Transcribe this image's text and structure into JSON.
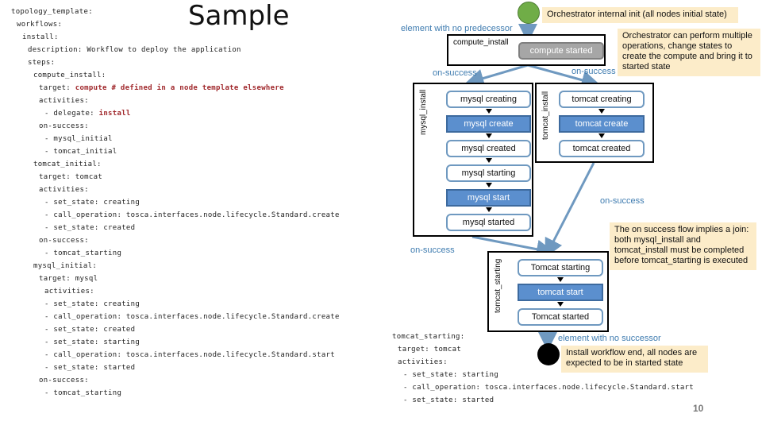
{
  "slide": {
    "title": "Sample",
    "page_number": "10"
  },
  "code": {
    "lines": [
      {
        "indent": 0,
        "text": "topology_template:"
      },
      {
        "indent": 1,
        "text": "workflows:"
      },
      {
        "indent": 2,
        "text": "install:"
      },
      {
        "indent": 3,
        "text": "description: Workflow to deploy the application"
      },
      {
        "indent": 3,
        "text": "steps:"
      },
      {
        "indent": 4,
        "text": "compute_install:"
      },
      {
        "indent": 5,
        "text": "target: ",
        "highlight": "compute # defined in a node template elsewhere"
      },
      {
        "indent": 5,
        "text": "activities:"
      },
      {
        "indent": 6,
        "text": "- delegate: ",
        "highlight": "install"
      },
      {
        "indent": 5,
        "text": "on-success:"
      },
      {
        "indent": 6,
        "text": "- mysql_initial"
      },
      {
        "indent": 6,
        "text": "- tomcat_initial"
      },
      {
        "indent": 4,
        "text": "tomcat_initial:"
      },
      {
        "indent": 5,
        "text": "target: tomcat"
      },
      {
        "indent": 5,
        "text": "activities:"
      },
      {
        "indent": 6,
        "text": "- set_state: creating"
      },
      {
        "indent": 6,
        "text": "- call_operation: tosca.interfaces.node.lifecycle.Standard.create"
      },
      {
        "indent": 6,
        "text": "- set_state: created"
      },
      {
        "indent": 5,
        "text": "on-success:"
      },
      {
        "indent": 6,
        "text": "- tomcat_starting"
      },
      {
        "indent": 4,
        "text": "mysql_initial:"
      },
      {
        "indent": 5,
        "text": "target: mysql"
      },
      {
        "indent": 6,
        "text": "activities:"
      },
      {
        "indent": 6,
        "text": "- set_state: creating"
      },
      {
        "indent": 6,
        "text": "- call_operation: tosca.interfaces.node.lifecycle.Standard.create"
      },
      {
        "indent": 6,
        "text": "- set_state: created"
      },
      {
        "indent": 6,
        "text": "- set_state: starting"
      },
      {
        "indent": 6,
        "text": "- call_operation: tosca.interfaces.node.lifecycle.Standard.start"
      },
      {
        "indent": 6,
        "text": "- set_state: started"
      },
      {
        "indent": 5,
        "text": "on-success:"
      },
      {
        "indent": 6,
        "text": "- tomcat_starting"
      }
    ],
    "lines2": [
      {
        "indent": 0,
        "text": "tomcat_starting:"
      },
      {
        "indent": 1,
        "text": "target: tomcat"
      },
      {
        "indent": 1,
        "text": "activities:"
      },
      {
        "indent": 2,
        "text": "- set_state: starting"
      },
      {
        "indent": 2,
        "text": "- call_operation: tosca.interfaces.node.lifecycle.Standard.start"
      },
      {
        "indent": 2,
        "text": "- set_state: started"
      }
    ]
  },
  "diagram": {
    "notes": {
      "init": "Orchestrator internal init (all nodes initial state)",
      "compute": "Orchestrator can perform multiple operations, change states to create the compute and bring it to started state",
      "join": "The on success flow implies a join: both mysql_install and tomcat_install must be completed before tomcat_starting is executed",
      "end": "Install workflow end, all nodes are expected to be in started state"
    },
    "labels": {
      "no_predecessor": "element with no predecessor",
      "no_successor": "element with no successor",
      "on_success_left": "on-success",
      "on_success_right": "on-success",
      "on_success_tomcat": "on-success",
      "on_success_mysql": "on-success"
    },
    "compute_install": {
      "name": "compute_install",
      "state": "compute started"
    },
    "mysql_install": {
      "name": "mysql_install",
      "states": [
        "mysql creating",
        "mysql create",
        "mysql created",
        "mysql starting",
        "mysql start",
        "mysql started"
      ]
    },
    "tomcat_install": {
      "name": "tomcat_install",
      "states": [
        "tomcat creating",
        "tomcat create",
        "tomcat created"
      ]
    },
    "tomcat_starting": {
      "name": "tomcat_starting",
      "states": [
        "Tomcat starting",
        "tomcat start",
        "Tomcat started"
      ]
    },
    "colors": {
      "start_node": "#70ad47",
      "end_node": "#000000",
      "operation_fill": "#5b8fce",
      "state_border": "#6f99c0",
      "note_bg": "#fcecc9",
      "connector": "#6f99c0",
      "label_blue": "#3f7cb0",
      "code_highlight": "#a0282c"
    }
  }
}
